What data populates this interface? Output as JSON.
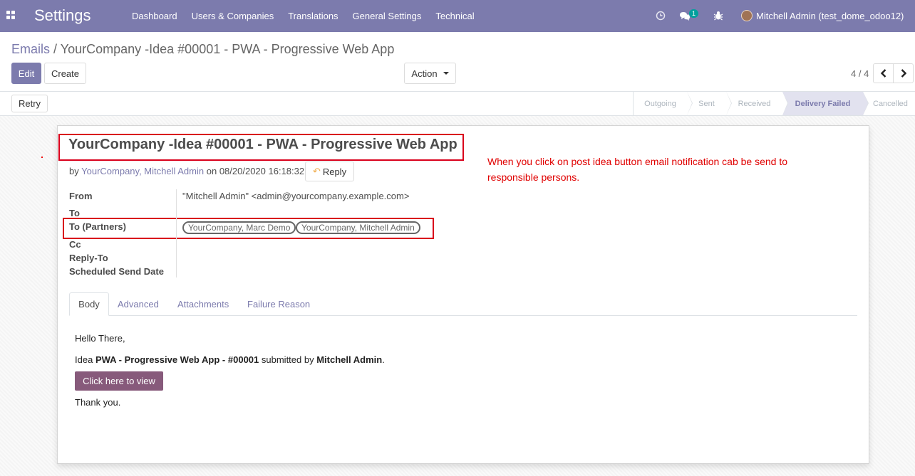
{
  "navbar": {
    "app_title": "Settings",
    "menu": [
      "Dashboard",
      "Users & Companies",
      "Translations",
      "General Settings",
      "Technical"
    ],
    "chat_badge": "1",
    "user_name": "Mitchell Admin (test_dome_odoo12)",
    "color": "#7c7bad"
  },
  "breadcrumb": {
    "parent": "Emails",
    "separator": "/",
    "current": "YourCompany -Idea #00001 - PWA - Progressive Web App"
  },
  "toolbar": {
    "edit_label": "Edit",
    "create_label": "Create",
    "action_label": "Action",
    "pager": "4 / 4"
  },
  "statusbar": {
    "retry_label": "Retry",
    "stages": [
      "Outgoing",
      "Sent",
      "Received",
      "Delivery Failed",
      "Cancelled"
    ],
    "active_stage": "Delivery Failed"
  },
  "mail": {
    "subject": "YourCompany -Idea #00001 - PWA - Progressive Web App",
    "by_prefix": "by",
    "author": "YourCompany, Mitchell Admin",
    "date_prefix": "on",
    "date": "08/20/2020 16:18:32",
    "reply_label": "Reply"
  },
  "note": "When you click on post idea button email notification cab be send to responsible persons.",
  "fields": {
    "from_label": "From",
    "from_value": "\"Mitchell Admin\" <admin@yourcompany.example.com>",
    "to_label": "To",
    "to_partners_label": "To (Partners)",
    "partners": [
      "YourCompany, Marc Demo",
      "YourCompany, Mitchell Admin"
    ],
    "cc_label": "Cc",
    "reply_to_label": "Reply-To",
    "scheduled_label": "Scheduled Send Date"
  },
  "tabs": [
    "Body",
    "Advanced",
    "Attachments",
    "Failure Reason"
  ],
  "body": {
    "greeting": "Hello There,",
    "idea_prefix": "Idea",
    "idea_name": "PWA - Progressive Web App",
    "idea_sep": "-",
    "idea_ref": "#00001",
    "submitted_by": "submitted by",
    "submitter": "Mitchell Admin",
    "period": ".",
    "view_button": "Click here to view",
    "thanks": "Thank you."
  }
}
